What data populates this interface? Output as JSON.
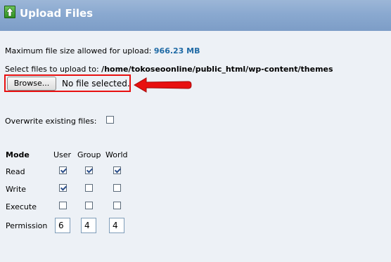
{
  "header": {
    "title": "Upload Files",
    "icon": "upload-icon"
  },
  "max_size": {
    "label": "Maximum file size allowed for upload:",
    "value": "966.23 MB"
  },
  "destination": {
    "label": "Select files to upload to:",
    "path": "/home/tokoseoonline/public_html/wp-content/themes"
  },
  "file_picker": {
    "button_label": "Browse...",
    "status": "No file selected."
  },
  "overwrite": {
    "label": "Overwrite existing files:",
    "checked": false
  },
  "permissions": {
    "header": {
      "mode": "Mode",
      "user": "User",
      "group": "Group",
      "world": "World"
    },
    "rows": [
      {
        "label": "Read",
        "user": true,
        "group": true,
        "world": true
      },
      {
        "label": "Write",
        "user": true,
        "group": false,
        "world": false
      },
      {
        "label": "Execute",
        "user": false,
        "group": false,
        "world": false
      }
    ],
    "permission_label": "Permission",
    "values": {
      "user": "6",
      "group": "4",
      "world": "4"
    }
  },
  "colors": {
    "header_bg": "#8aa9d0",
    "highlight": "#e81010",
    "value_blue": "#1f6aa5",
    "page_bg": "#edf1f6"
  }
}
